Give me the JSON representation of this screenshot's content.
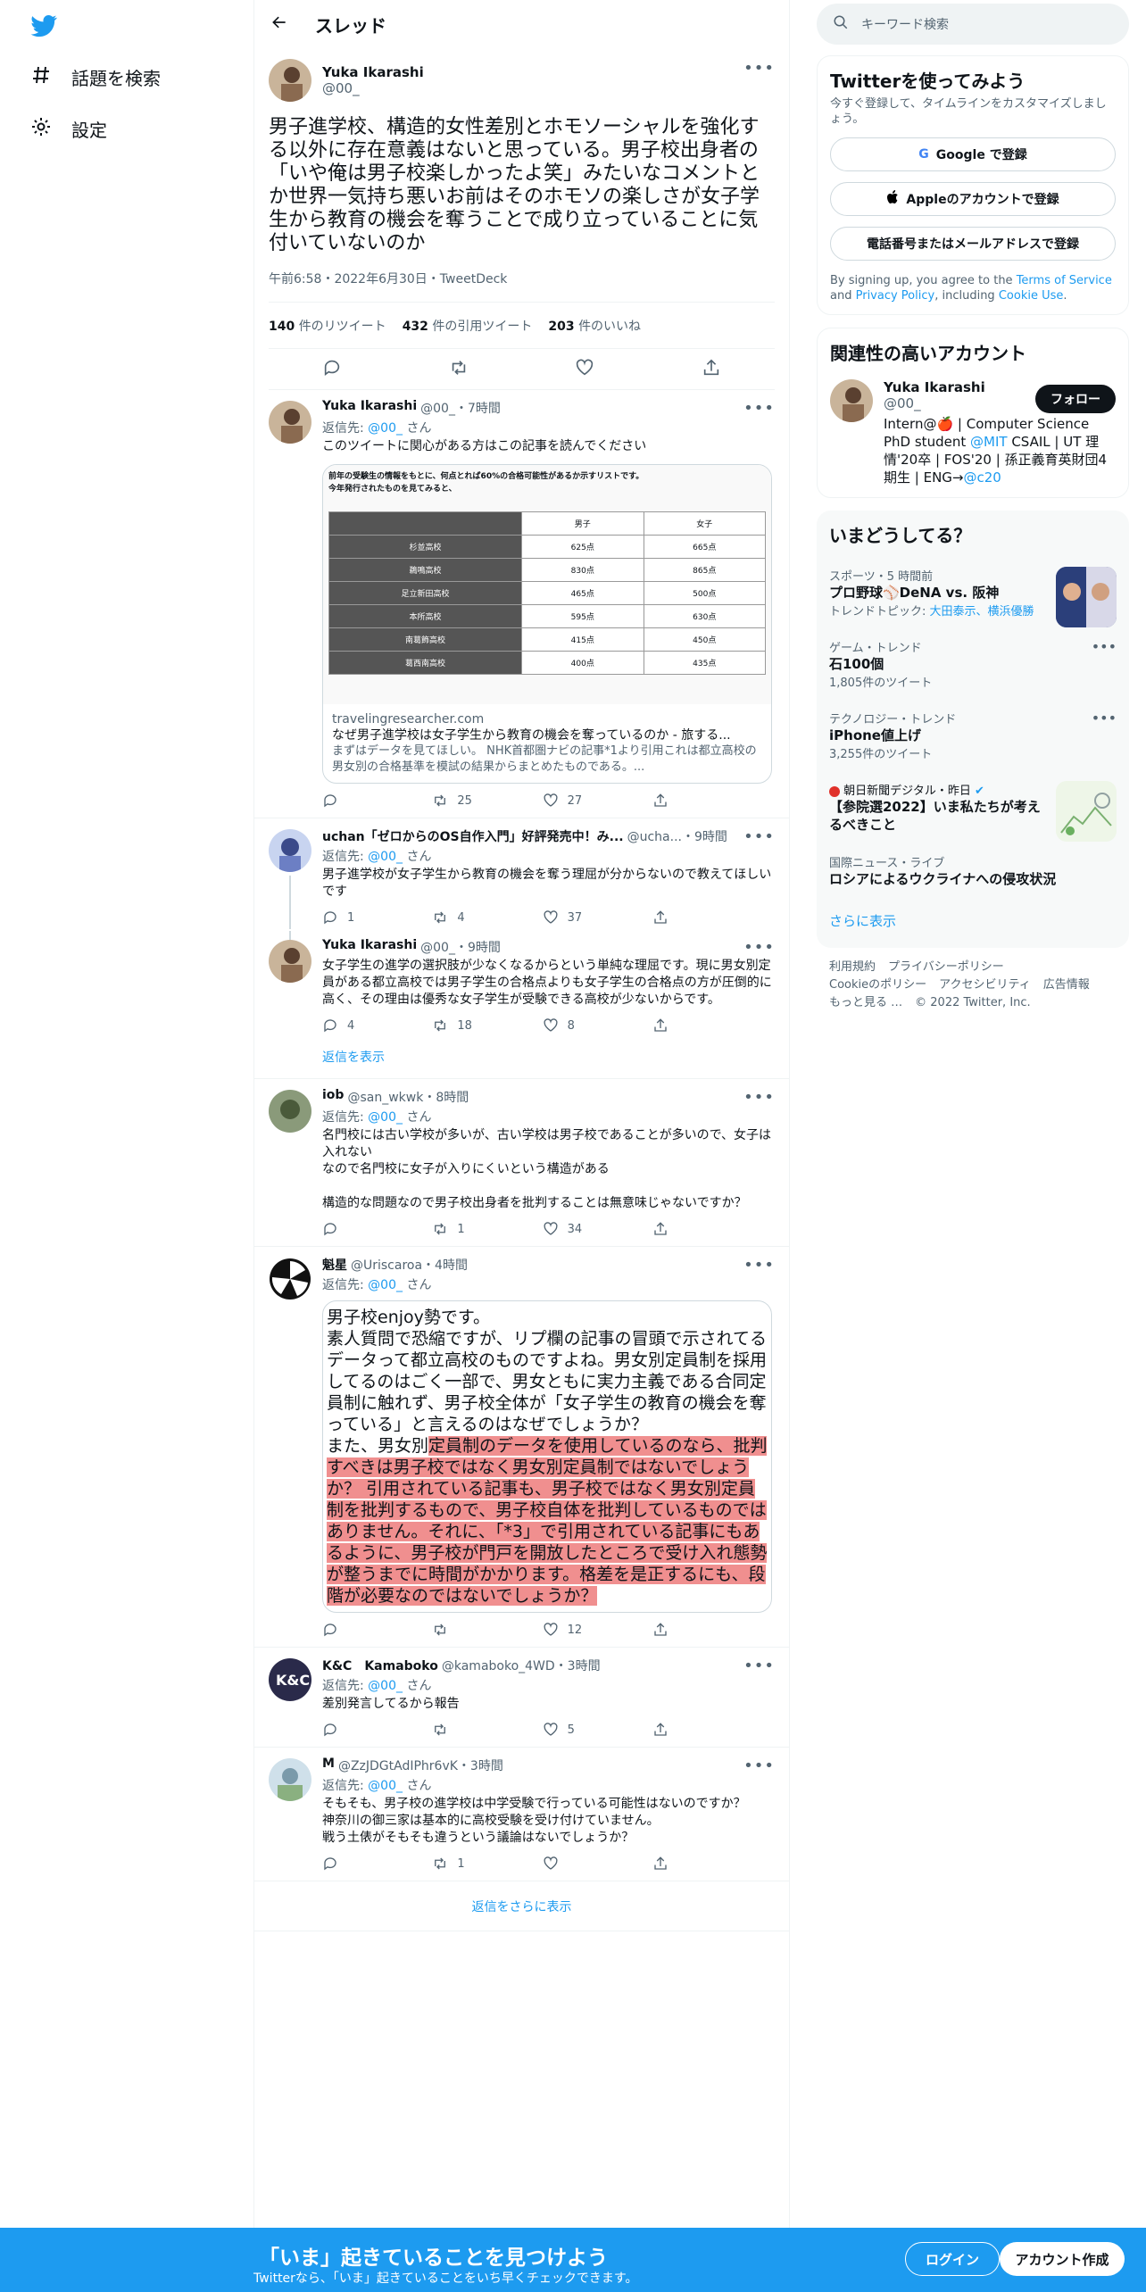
{
  "nav": {
    "explore": "話題を検索",
    "settings": "設定"
  },
  "header": {
    "title": "スレッド"
  },
  "main_tweet": {
    "name": "Yuka Ikarashi",
    "handle": "@00_",
    "text": "男子進学校、構造的女性差別とホモソーシャルを強化する以外に存在意義はないと思っている。男子校出身者の「いや俺は男子校楽しかったよ笑」みたいなコメントとか世界一気持ち悪いお前はそのホモソの楽しさが女子学生から教育の機会を奪うことで成り立っていることに気付いていないのか",
    "meta": "午前6:58・2022年6月30日・TweetDeck",
    "retweets": "140",
    "retweets_label": "件のリツイート",
    "quotes": "432",
    "quotes_label": "件の引用ツイート",
    "likes": "203",
    "likes_label": "件のいいね"
  },
  "replies": [
    {
      "name": "Yuka Ikarashi",
      "handle": "@00_・7時間",
      "reply_to": "返信先:",
      "reply_handle": "@00_",
      "reply_san": "さん",
      "text": "このツイートに関心がある方はこの記事を読んでください",
      "retweets": "25",
      "likes": "27",
      "card": {
        "caption": "前年の受験生の情報をもとに、何点とれば60%の合格可能性があるか示すリストです。\n今年発行されたものを見てみると、",
        "col_boys": "男子",
        "col_girls": "女子",
        "rows": [
          [
            "杉並高校",
            "625点",
            "665点"
          ],
          [
            "鵜鳴高校",
            "830点",
            "865点"
          ],
          [
            "足立新田高校",
            "465点",
            "500点"
          ],
          [
            "本所高校",
            "595点",
            "630点"
          ],
          [
            "南葛飾高校",
            "415点",
            "450点"
          ],
          [
            "葛西南高校",
            "400点",
            "435点"
          ]
        ],
        "domain": "travelingresearcher.com",
        "title": "なぜ男子進学校は女子学生から教育の機会を奪っているのか - 旅する...",
        "desc": "まずはデータを見てほしい。 NHK首都圏ナビの記事*1より引用これは都立高校の男女別の合格基準を模試の結果からまとめたものである。..."
      }
    },
    {
      "name": "uchan「ゼロからのOS自作入門」好評発売中！み...",
      "handle": "@ucha...・9時間",
      "reply_to": "返信先:",
      "reply_handle": "@00_",
      "reply_san": "さん",
      "text": "男子進学校が女子学生から教育の機会を奪う理屈が分からないので教えてほしいです",
      "replies": "1",
      "retweets": "4",
      "likes": "37"
    },
    {
      "name": "Yuka Ikarashi",
      "handle": "@00_・9時間",
      "text": "女子学生の進学の選択肢が少なくなるからという単純な理屈です。現に男女別定員がある都立高校では男子学生の合格点よりも女子学生の合格点の方が圧倒的に高く、その理由は優秀な女子学生が受験できる高校が少ないからです。",
      "replies": "4",
      "retweets": "18",
      "likes": "8",
      "show_replies": "返信を表示"
    },
    {
      "name": "iob",
      "handle": "@san_wkwk・8時間",
      "reply_to": "返信先:",
      "reply_handle": "@00_",
      "reply_san": "さん",
      "text": "名門校には古い学校が多いが、古い学校は男子校であることが多いので、女子は入れない\nなので名門校に女子が入りにくいという構造がある\n\n構造的な問題なので男子校出身者を批判することは無意味じゃないですか？",
      "retweets": "1",
      "likes": "34"
    },
    {
      "name": "魁星",
      "handle": "@Uriscaroa・4時間",
      "reply_to": "返信先:",
      "reply_handle": "@00_",
      "reply_san": "さん",
      "img_text_plain": "男子校enjoy勢です。\n素人質問で恐縮ですが、リプ欄の記事の冒頭で示されてるデータって都立高校のものですよね。男女別定員制を採用してるのはごく一部で、男女ともに実力主義である合同定員制に触れず、男子校全体が「女子学生の教育の機会を奪っている」と言えるのはなぜでしょうか？\nまた、男女別",
      "img_text_hl": "定員制のデータを使用しているのなら、批判すべきは男子校ではなく男女別定員制ではないでしょうか？ 引用されている記事も、男子校ではなく男女別定員制を批判するもので、男子校自体を批判しているものではありません。それに、「*3」で引用されている記事にもあるように、男子校が門戸を開放したところで受け入れ態勢が整うまでに時間がかかります。格差を是正するにも、段階が必要なのではないでしょうか？",
      "likes": "12"
    },
    {
      "name": "K&C　Kamaboko",
      "handle": "@kamaboko_4WD・3時間",
      "reply_to": "返信先:",
      "reply_handle": "@00_",
      "reply_san": "さん",
      "text": "差別発言してるから報告",
      "likes": "5"
    },
    {
      "name": "M",
      "handle": "@ZzJDGtAdIPhr6vK・3時間",
      "reply_to": "返信先:",
      "reply_handle": "@00_",
      "reply_san": "さん",
      "text": "そもそも、男子校の進学校は中学受験で行っている可能性はないのですか？\n神奈川の御三家は基本的に高校受験を受け付けていません。\n戦う土俵がそもそも違うという議論はないでしょうか？",
      "retweets": "1"
    }
  ],
  "more_replies": "返信をさらに表示",
  "sidebar": {
    "search_placeholder": "キーワード検索",
    "signup": {
      "title": "Twitterを使ってみよう",
      "sub": "今すぐ登録して、タイムラインをカスタマイズしましょう。",
      "google": "Google で登録",
      "apple": "Appleのアカウントで登録",
      "phone": "電話番号またはメールアドレスで登録",
      "terms_1": "By signing up, you agree to the",
      "terms_link": "Terms of Service",
      "terms_2": "and",
      "privacy": "Privacy Policy",
      "terms_3": ", including",
      "cookie": "Cookie Use",
      "terms_4": "."
    },
    "related": {
      "title": "関連性の高いアカウント",
      "name": "Yuka Ikarashi",
      "handle": "@00_",
      "follow": "フォロー",
      "bio_1": "Intern@🍎 | Computer Science PhD student",
      "bio_mit": "@MIT",
      "bio_2": "CSAIL | UT 理情'20卒 | FOS'20 | 孫正義育英財団4期生 | ENG→",
      "bio_c20": "@c20"
    },
    "trends": {
      "title": "いまどうしてる？",
      "items": [
        {
          "cat": "スポーツ・5 時間前",
          "name": "プロ野球⚾DeNA vs. 阪神",
          "sub": "トレンドトピック:",
          "sub_links": "大田泰示、横浜優勝"
        },
        {
          "cat": "ゲーム・トレンド",
          "name": "石100個",
          "sub": "1,805件のツイート"
        },
        {
          "cat": "テクノロジー・トレンド",
          "name": "iPhone値上げ",
          "sub": "3,255件のツイート"
        },
        {
          "cat": "朝日新聞デジタル・昨日",
          "name": "【参院選2022】いま私たちが考えるべきこと"
        },
        {
          "cat": "国際ニュース・ライブ",
          "name": "ロシアによるウクライナへの侵攻状況"
        }
      ],
      "show_more": "さらに表示"
    },
    "footer": {
      "l1": "利用規約",
      "l2": "プライバシーポリシー",
      "l3": "Cookieのポリシー",
      "l4": "アクセシビリティ",
      "l5": "広告情報",
      "l6": "もっと見る …",
      "l7": "© 2022 Twitter, Inc."
    }
  },
  "banner": {
    "title": "「いま」起きていることを見つけよう",
    "sub": "Twitterなら、「いま」起きていることをいち早くチェックできます。",
    "login": "ログイン",
    "signup": "アカウント作成"
  },
  "colors": {
    "accent": "#1d9bf0",
    "text": "#0f1419",
    "muted": "#536471",
    "highlight": "#f08f8f"
  }
}
